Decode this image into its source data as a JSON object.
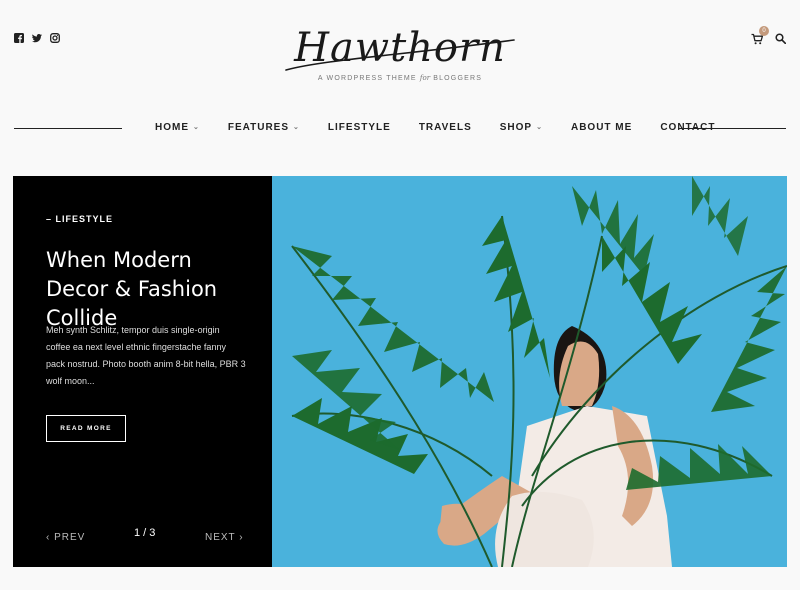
{
  "header": {
    "social": [
      "facebook-icon",
      "twitter-icon",
      "instagram-icon"
    ],
    "logo": {
      "name": "Hawthorn",
      "tagline_a": "A WORDPRESS THEME",
      "tagline_em": "for",
      "tagline_b": "BLOGGERS"
    },
    "cart_count": "0"
  },
  "nav": {
    "items": [
      {
        "label": "HOME",
        "dropdown": true
      },
      {
        "label": "FEATURES",
        "dropdown": true
      },
      {
        "label": "LIFESTYLE",
        "dropdown": false
      },
      {
        "label": "TRAVELS",
        "dropdown": false
      },
      {
        "label": "SHOP",
        "dropdown": true
      },
      {
        "label": "ABOUT ME",
        "dropdown": false
      },
      {
        "label": "CONTACT",
        "dropdown": false
      }
    ],
    "chevron": "⌄"
  },
  "slide": {
    "category": "– LIFESTYLE",
    "title": "When Modern Decor & Fashion Collide",
    "excerpt": "Meh synth Schlitz, tempor duis single-origin coffee ea next level ethnic fingerstache fanny pack nostrud. Photo booth anim 8-bit hella, PBR 3 wolf moon...",
    "read_more": "READ MORE",
    "prev": "‹ PREV",
    "next": "NEXT ›",
    "pager": "1 / 3"
  },
  "colors": {
    "accent": "#c49a7c",
    "photo_bg": "#4ab2dc",
    "panel_bg": "#000000"
  }
}
